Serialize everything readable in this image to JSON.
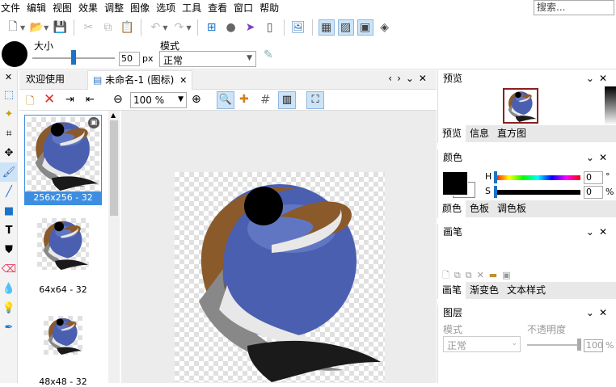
{
  "menu": [
    "文件",
    "编辑",
    "视图",
    "效果",
    "调整",
    "图像",
    "选项",
    "工具",
    "查看",
    "窗口",
    "帮助"
  ],
  "search_placeholder": "搜索...",
  "options": {
    "size_label": "大小",
    "size_value": "50",
    "size_unit": "px",
    "mode_label": "模式",
    "mode_value": "正常",
    "size_fraction": 0.5
  },
  "tabs": {
    "welcome": "欢迎使用",
    "document": "未命名-1 (图标)"
  },
  "doc_toolbar": {
    "zoom": "100 %"
  },
  "thumbnails": [
    {
      "label": "256x256 - 32"
    },
    {
      "label": "64x64 - 32"
    },
    {
      "label": "48x48 - 32"
    }
  ],
  "panels": {
    "preview": {
      "title": "预览",
      "tabs": [
        "预览",
        "信息",
        "直方图"
      ]
    },
    "color": {
      "title": "颜色",
      "h_label": "H",
      "s_label": "S",
      "h_value": "0",
      "s_value": "0",
      "h_unit": "°",
      "s_unit": "%",
      "tabs": [
        "颜色",
        "色板",
        "调色板"
      ],
      "swatch": "#000000"
    },
    "brush": {
      "title": "画笔",
      "tabs": [
        "画笔",
        "渐变色",
        "文本样式"
      ]
    },
    "layers": {
      "title": "图层",
      "mode_label": "模式",
      "opacity_label": "不透明度",
      "mode_value": "正常",
      "opacity_value": "100",
      "opacity_unit": "%"
    }
  },
  "close_glyph": "✕",
  "colors": {
    "accent": "#3d8ee0",
    "logo_blue": "#4a5fb0",
    "logo_brown": "#8a5a2b"
  }
}
